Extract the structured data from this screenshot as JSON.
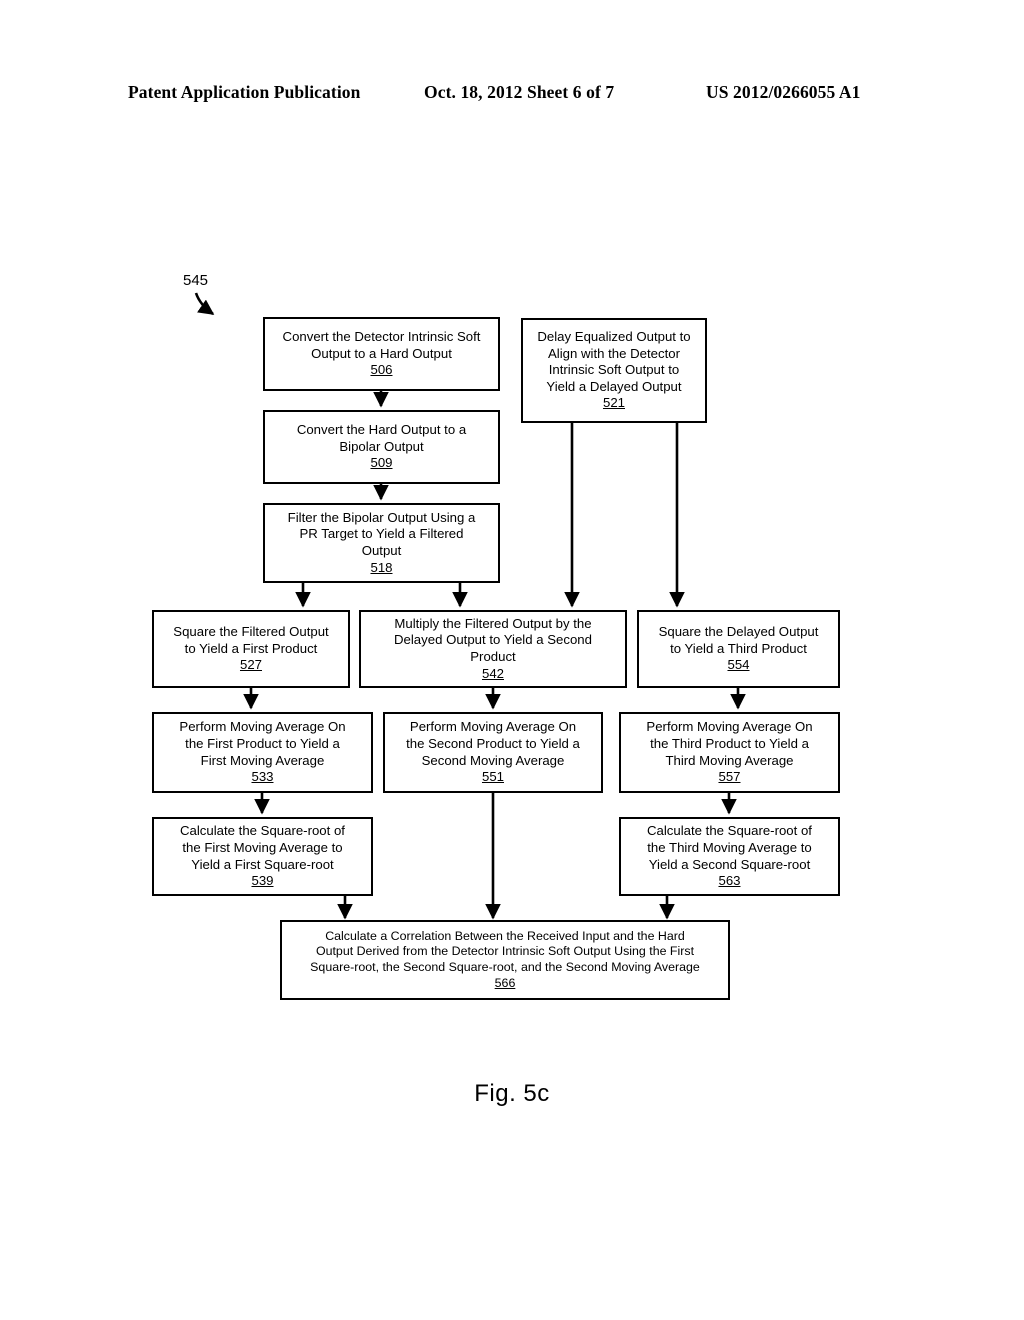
{
  "header": {
    "left": "Patent Application Publication",
    "middle": "Oct. 18, 2012  Sheet 6 of 7",
    "right": "US 2012/0266055 A1"
  },
  "figure": {
    "caption": "Fig. 5c",
    "diagram_ref": "545"
  },
  "nodes": [
    {
      "id": "n506",
      "text": "Convert the Detector Intrinsic Soft\nOutput to a Hard Output",
      "ref": "506"
    },
    {
      "id": "n509",
      "text": "Convert the Hard Output to a\nBipolar Output",
      "ref": "509"
    },
    {
      "id": "n518",
      "text": "Filter the Bipolar Output Using a\nPR Target to Yield a Filtered\nOutput",
      "ref": "518"
    },
    {
      "id": "n521",
      "text": "Delay Equalized Output to\nAlign with the Detector\nIntrinsic Soft Output to\nYield a Delayed Output",
      "ref": "521"
    },
    {
      "id": "n527",
      "text": "Square the Filtered Output\nto Yield a First Product",
      "ref": "527"
    },
    {
      "id": "n542",
      "text": "Multiply the Filtered Output by the\nDelayed Output to Yield a Second\nProduct",
      "ref": "542"
    },
    {
      "id": "n554",
      "text": "Square the Delayed Output\nto Yield a Third Product",
      "ref": "554"
    },
    {
      "id": "n533",
      "text": "Perform Moving Average On\nthe First Product to Yield a\nFirst Moving Average",
      "ref": "533"
    },
    {
      "id": "n551",
      "text": "Perform Moving Average On\nthe Second Product to Yield a\nSecond Moving Average",
      "ref": "551"
    },
    {
      "id": "n557",
      "text": "Perform Moving Average On\nthe Third Product to Yield a\nThird Moving Average",
      "ref": "557"
    },
    {
      "id": "n539",
      "text": "Calculate the Square-root of\nthe First Moving Average to\nYield a First Square-root",
      "ref": "539"
    },
    {
      "id": "n563",
      "text": "Calculate the Square-root of\nthe Third Moving Average to\nYield a Second Square-root",
      "ref": "563"
    },
    {
      "id": "n566",
      "text": "Calculate a Correlation Between the Received Input and the Hard\nOutput Derived from the Detector Intrinsic Soft Output Using the First\nSquare-root, the Second Square-root, and the Second Moving Average",
      "ref": "566"
    }
  ]
}
